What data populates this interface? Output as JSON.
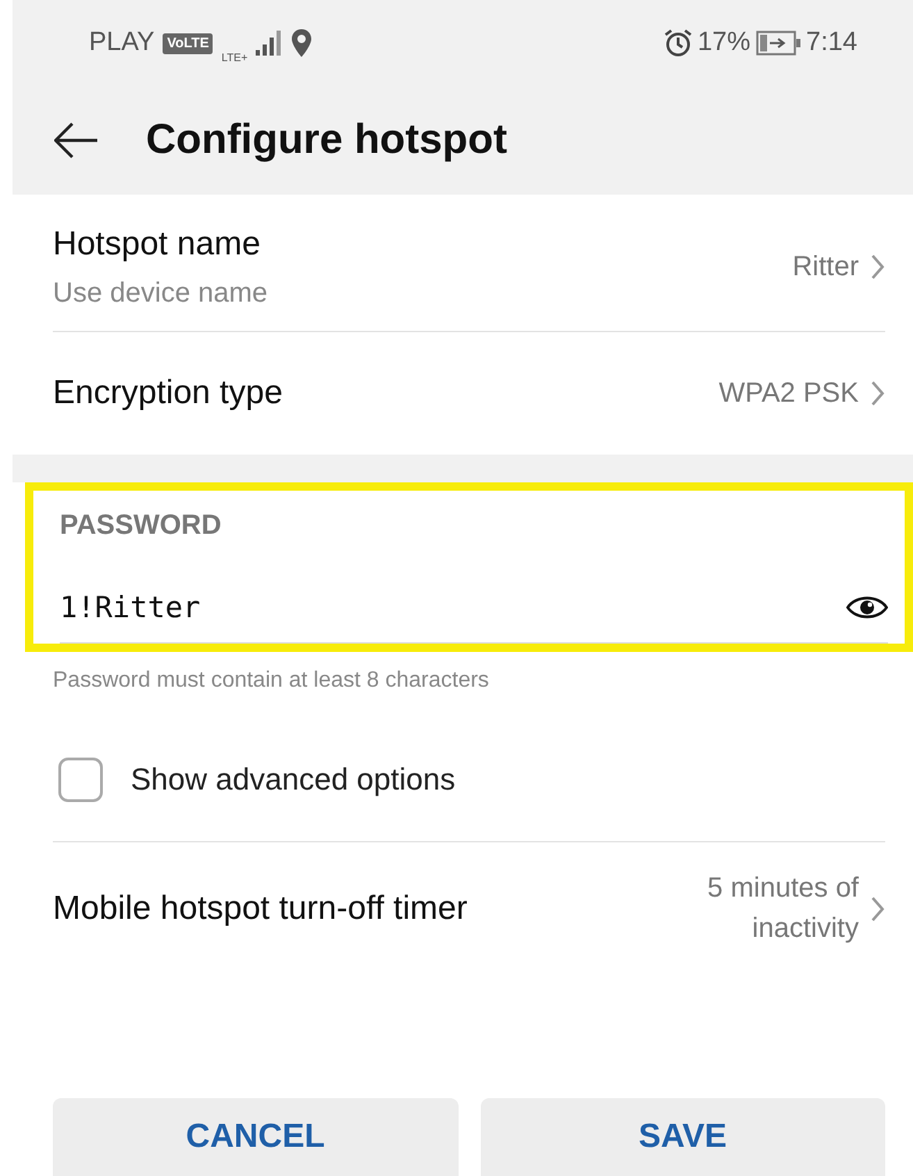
{
  "status_bar": {
    "carrier": "PLAY",
    "volte": "VoLTE",
    "network": "LTE+",
    "battery_percent": "17%",
    "time": "7:14"
  },
  "header": {
    "title": "Configure hotspot"
  },
  "settings": [
    {
      "kind": "value_row",
      "label": "Hotspot name",
      "sublabel": "Use device name",
      "value": "Ritter"
    },
    {
      "kind": "value_row",
      "label": "Encryption type",
      "value": "WPA2 PSK"
    }
  ],
  "password": {
    "label": "PASSWORD",
    "value": "1!Ritter",
    "hint": "Password must contain at least 8 characters",
    "highlighted": true
  },
  "advanced": {
    "label": "Show advanced options",
    "checked": false
  },
  "timer": {
    "label": "Mobile hotspot turn-off timer",
    "value": "5 minutes of inactivity"
  },
  "buttons": [
    {
      "label": "CANCEL"
    },
    {
      "label": "SAVE"
    }
  ]
}
